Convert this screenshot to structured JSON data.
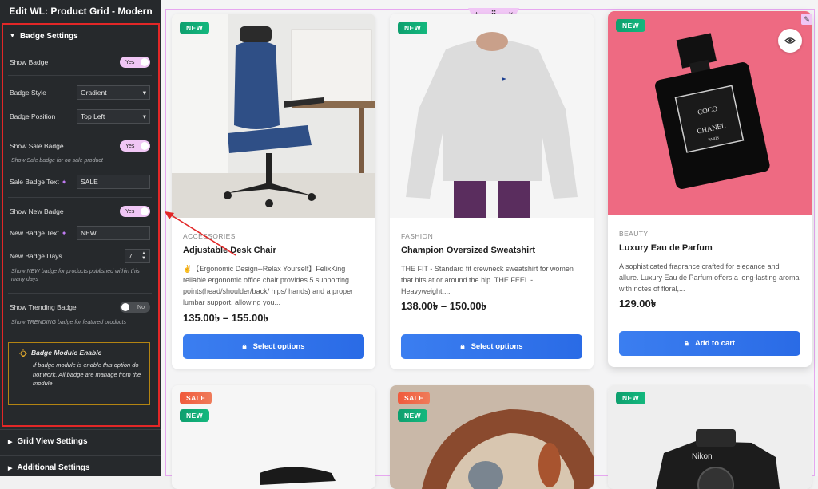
{
  "editor": {
    "title": "Edit WL: Product Grid - Modern",
    "badge_settings": {
      "heading": "Badge Settings",
      "show_badge": {
        "label": "Show Badge",
        "value": "Yes"
      },
      "badge_style": {
        "label": "Badge Style",
        "value": "Gradient"
      },
      "badge_position": {
        "label": "Badge Position",
        "value": "Top Left"
      },
      "show_sale_badge": {
        "label": "Show Sale Badge",
        "value": "Yes",
        "hint": "Show Sale badge for on sale product"
      },
      "sale_badge_text": {
        "label": "Sale Badge Text",
        "value": "SALE"
      },
      "show_new_badge": {
        "label": "Show New Badge",
        "value": "Yes"
      },
      "new_badge_text": {
        "label": "New Badge Text",
        "value": "NEW"
      },
      "new_badge_days": {
        "label": "New Badge Days",
        "value": "7",
        "hint": "Show NEW badge for products published within this many days"
      },
      "show_trending_badge": {
        "label": "Show Trending Badge",
        "value": "No",
        "hint": "Show TRENDING badge for featured products"
      },
      "notice": {
        "title": "Badge Module Enable",
        "body": "If badge module is enable this option do not work, All badge are manage from the module"
      }
    },
    "sections": [
      "Grid View Settings",
      "Additional Settings"
    ]
  },
  "products": [
    {
      "category": "ACCESSORIES",
      "title": "Adjustable Desk Chair",
      "description": "✌️【Ergonomic Design--Relax Yourself】FelixKing reliable ergonomic office chair provides 5 supporting points(head/shoulder/back/ hips/ hands) and a proper lumbar support, allowing you...",
      "price": "135.00৳ – 155.00৳",
      "button": "Select options",
      "badges": [
        "NEW"
      ]
    },
    {
      "category": "FASHION",
      "title": "Champion Oversized Sweatshirt",
      "description": "THE FIT - Standard fit crewneck sweatshirt for women that hits at or around the hip. THE FEEL - Heavyweight,...",
      "price": "138.00৳ – 150.00৳",
      "button": "Select options",
      "badges": [
        "NEW"
      ]
    },
    {
      "category": "BEAUTY",
      "title": "Luxury Eau de Parfum",
      "description": "A sophisticated fragrance crafted for elegance and allure. Luxury Eau de Parfum offers a long-lasting aroma with notes of floral,...",
      "price": "129.00৳",
      "button": "Add to cart",
      "badges": [
        "NEW"
      ]
    },
    {
      "badges": [
        "SALE",
        "NEW"
      ]
    },
    {
      "badges": [
        "SALE",
        "NEW"
      ]
    },
    {
      "badges": [
        "NEW"
      ]
    }
  ],
  "product_image_text": {
    "perfume_label": "COCO CHANEL PARIS",
    "camera_brand": "Nikon"
  },
  "colors": {
    "accent_pink": "#f0c6f5",
    "badge_new": "#0e9f6e",
    "badge_sale": "#f05a3c",
    "button_blue": "#2f74eb",
    "highlight_red": "#e22727"
  }
}
